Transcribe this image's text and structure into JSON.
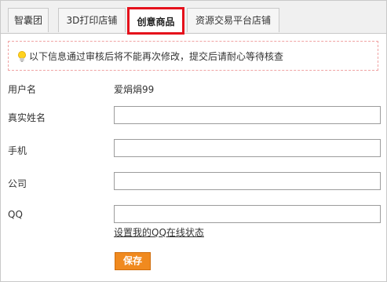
{
  "tabs": [
    {
      "label": "智囊团"
    },
    {
      "label": "3D打印店铺"
    },
    {
      "label": "创意商品"
    },
    {
      "label": "资源交易平台店铺"
    }
  ],
  "notice": {
    "icon": "lightbulb-icon",
    "text": "以下信息通过审核后将不能再次修改，提交后请耐心等待核查"
  },
  "form": {
    "username_label": "用户名",
    "username_value": "爱焆焆99",
    "realname_label": "真实姓名",
    "realname_value": "",
    "phone_label": "手机",
    "phone_value": "",
    "company_label": "公司",
    "company_value": "",
    "qq_label": "QQ",
    "qq_value": "",
    "qq_status_link": "设置我的QQ在线状态",
    "save_label": "保存"
  },
  "colors": {
    "active_tab_border": "#e5101b",
    "save_button": "#f08a1f",
    "notice_border": "#f0a3a3"
  }
}
